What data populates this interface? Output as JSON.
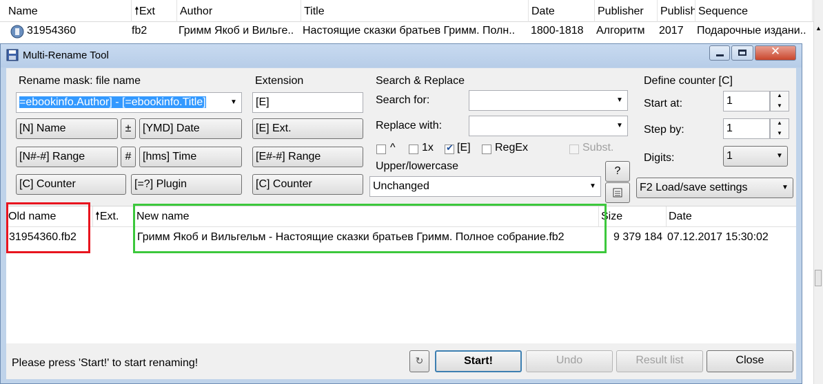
{
  "background_list": {
    "columns": [
      "Name",
      "Ext",
      "Author",
      "Title",
      "Date",
      "Publisher",
      "Publish",
      "Sequence"
    ],
    "row": {
      "name": "31954360",
      "ext": "fb2",
      "author": "Гримм Якоб и Вильге..",
      "title": "Настоящие сказки братьев Гримм. Полн..",
      "date": "1800-1818",
      "publisher": "Алгоритм",
      "publish": "2017",
      "sequence": "Подарочные издани.."
    }
  },
  "dialog": {
    "title": "Multi-Rename Tool",
    "rename_mask": {
      "label": "Rename mask: file name",
      "value": "=ebookinfo.Author] - [=ebookinfo.Title]",
      "buttons": [
        "[N]  Name",
        "±",
        "[YMD]  Date",
        "[N#-#]  Range",
        "#",
        "[hms]  Time",
        "[C]  Counter",
        "[=?]  Plugin"
      ]
    },
    "extension": {
      "label": "Extension",
      "value": "[E]",
      "buttons": [
        "[E]  Ext.",
        "[E#-#]  Range",
        "[C]  Counter"
      ]
    },
    "search_replace": {
      "label": "Search & Replace",
      "search_label": "Search for:",
      "search_value": "",
      "replace_label": "Replace with:",
      "replace_value": "",
      "checkboxes": {
        "caret": {
          "label": "^",
          "checked": false
        },
        "once": {
          "label": "1x",
          "checked": false
        },
        "ext": {
          "label": "[E]",
          "checked": true
        },
        "regex": {
          "label": "RegEx",
          "checked": false
        },
        "subst": {
          "label": "Subst.",
          "checked": false,
          "disabled": true
        }
      },
      "case_label": "Upper/lowercase",
      "case_value": "Unchanged",
      "help_button": "?",
      "case_list_icon": "list-icon"
    },
    "counter": {
      "label": "Define counter [C]",
      "start_label": "Start at:",
      "start_value": "1",
      "step_label": "Step by:",
      "step_value": "1",
      "digits_label": "Digits:",
      "digits_value": "1",
      "settings_label": "F2 Load/save settings"
    },
    "list": {
      "headers": {
        "old": "Old name",
        "ext": "Ext.",
        "new": "New name",
        "size": "Size",
        "date": "Date"
      },
      "rows": [
        {
          "old": "31954360.fb2",
          "new": "Гримм Якоб и Вильгельм - Настоящие сказки братьев Гримм. Полное собрание.fb2",
          "size": "9 379 184",
          "date": "07.12.2017 15:30:02"
        }
      ]
    },
    "status_text": "Please press 'Start!' to start renaming!",
    "buttons": {
      "start": "Start!",
      "undo": "Undo",
      "result": "Result list",
      "close": "Close"
    },
    "highlight_colors": {
      "old_name": "#e8141e",
      "new_name": "#3cc83c"
    }
  }
}
